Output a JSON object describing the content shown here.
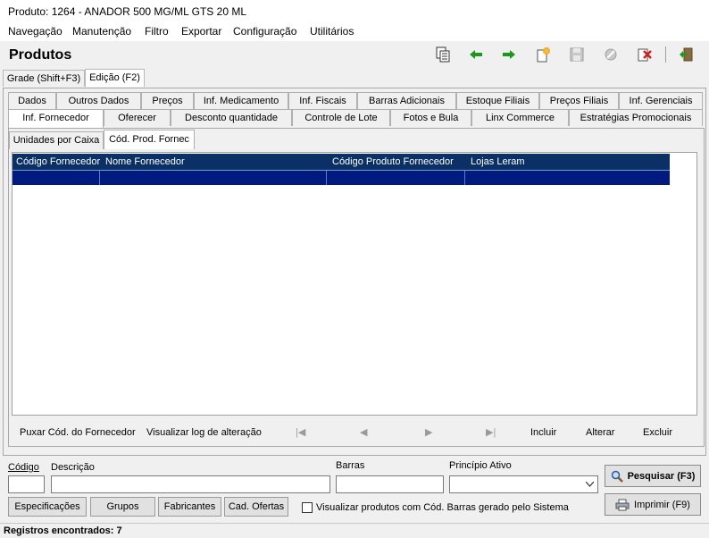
{
  "window": {
    "title": "Produto: 1264 - ANADOR 500 MG/ML GTS 20 ML"
  },
  "menu": [
    {
      "label": "Navegação"
    },
    {
      "label": "Manutenção"
    },
    {
      "label": "Filtro"
    },
    {
      "label": "Exportar"
    },
    {
      "label": "Configuração"
    },
    {
      "label": "Utilitários"
    }
  ],
  "header": {
    "title": "Produtos"
  },
  "toolbar": {
    "icons": [
      "copy-icon",
      "back-arrow-icon",
      "forward-arrow-icon",
      "new-icon",
      "save-icon",
      "cancel-icon",
      "delete-icon",
      "exit-icon"
    ],
    "colors": {
      "arrow": "#1a9a1a",
      "new": "#f0a020",
      "delete": "#d02020",
      "disabled": "#b0b0b0"
    }
  },
  "mode_tabs": [
    {
      "label": "Grade (Shift+F3)"
    },
    {
      "label": "Edição (F2)"
    }
  ],
  "tabs_row1": [
    {
      "label": "Dados"
    },
    {
      "label": "Outros Dados"
    },
    {
      "label": "Preços"
    },
    {
      "label": "Inf. Medicamento"
    },
    {
      "label": "Inf. Fiscais"
    },
    {
      "label": "Barras Adicionais"
    },
    {
      "label": "Estoque Filiais"
    },
    {
      "label": "Preços Filiais"
    },
    {
      "label": "Inf. Gerenciais"
    }
  ],
  "tabs_row2": [
    {
      "label": "Inf. Fornecedor"
    },
    {
      "label": "Oferecer"
    },
    {
      "label": "Desconto quantidade"
    },
    {
      "label": "Controle de Lote"
    },
    {
      "label": "Fotos e Bula"
    },
    {
      "label": "Linx Commerce"
    },
    {
      "label": "Estratégias Promocionais"
    }
  ],
  "sub_tabs": [
    {
      "label": "Unidades por Caixa"
    },
    {
      "label": "Cód. Prod. Fornec"
    }
  ],
  "grid": {
    "columns": [
      "Código Fornecedor",
      "Nome Fornecedor",
      "Código Produto Fornecedor",
      "Lojas Leram"
    ],
    "header_color": "#0a3066",
    "selected_row_color": "#001a80"
  },
  "grid_actions": {
    "pull": "Puxar Cód. do Fornecedor",
    "log": "Visualizar log de alteração",
    "first": "|◀",
    "prev": "◀",
    "next": "▶",
    "last": "▶|",
    "include": "Incluir",
    "edit": "Alterar",
    "delete": "Excluir"
  },
  "search": {
    "codigo_label": "Código",
    "descricao_label": "Descrição",
    "barras_label": "Barras",
    "principio_label": "Princípio Ativo",
    "codigo_value": "",
    "descricao_value": "",
    "barras_value": "",
    "principio_value": ""
  },
  "buttons": {
    "especificacoes": "Especificações",
    "grupos": "Grupos",
    "fabricantes": "Fabricantes",
    "ofertas": "Cad. Ofertas",
    "pesquisar": "Pesquisar (F3)",
    "imprimir": "Imprimir (F9)"
  },
  "checkbox": {
    "label": "Visualizar produtos com Cód. Barras gerado pelo Sistema",
    "checked": false
  },
  "status": {
    "text": "Registros encontrados: 7"
  }
}
